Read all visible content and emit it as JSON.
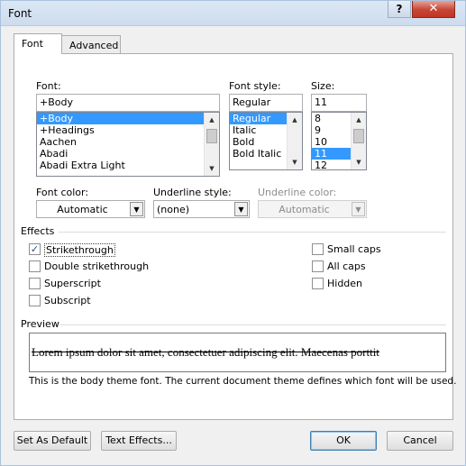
{
  "window": {
    "title": "Font",
    "help_label": "?",
    "close_label": "✕"
  },
  "tabs": [
    {
      "label": "Font",
      "active": true
    },
    {
      "label": "Advanced",
      "active": false
    }
  ],
  "font": {
    "label": "Font:",
    "value": "+Body",
    "items": [
      "+Body",
      "+Headings",
      "Aachen",
      "Abadi",
      "Abadi Extra Light"
    ],
    "selected_index": 0
  },
  "font_style": {
    "label": "Font style:",
    "value": "Regular",
    "items": [
      "Regular",
      "Italic",
      "Bold",
      "Bold Italic"
    ],
    "selected_index": 0
  },
  "size": {
    "label": "Size:",
    "value": "11",
    "items": [
      "8",
      "9",
      "10",
      "11",
      "12"
    ],
    "selected_index": 3
  },
  "font_color": {
    "label": "Font color:",
    "value": "Automatic"
  },
  "underline_style": {
    "label": "Underline style:",
    "value": "(none)"
  },
  "underline_color": {
    "label": "Underline color:",
    "value": "Automatic",
    "enabled": false
  },
  "effects": {
    "label": "Effects",
    "left": [
      {
        "label": "Strikethrough",
        "checked": true
      },
      {
        "label": "Double strikethrough",
        "checked": false
      },
      {
        "label": "Superscript",
        "checked": false
      },
      {
        "label": "Subscript",
        "checked": false
      }
    ],
    "right": [
      {
        "label": "Small caps",
        "checked": false
      },
      {
        "label": "All caps",
        "checked": false
      },
      {
        "label": "Hidden",
        "checked": false
      }
    ]
  },
  "preview": {
    "label": "Preview",
    "sample_text": "Lorem ipsum dolor sit amet, consectetuer adipiscing elit. Maecenas porttit",
    "description": "This is the body theme font. The current document theme defines which font will be used."
  },
  "buttons": {
    "set_as_default": "Set As Default",
    "text_effects": "Text Effects...",
    "ok": "OK",
    "cancel": "Cancel"
  },
  "colors": {
    "selection": "#3399ff",
    "checkmark": "#2a4f8b",
    "close_button": "#c74535"
  }
}
